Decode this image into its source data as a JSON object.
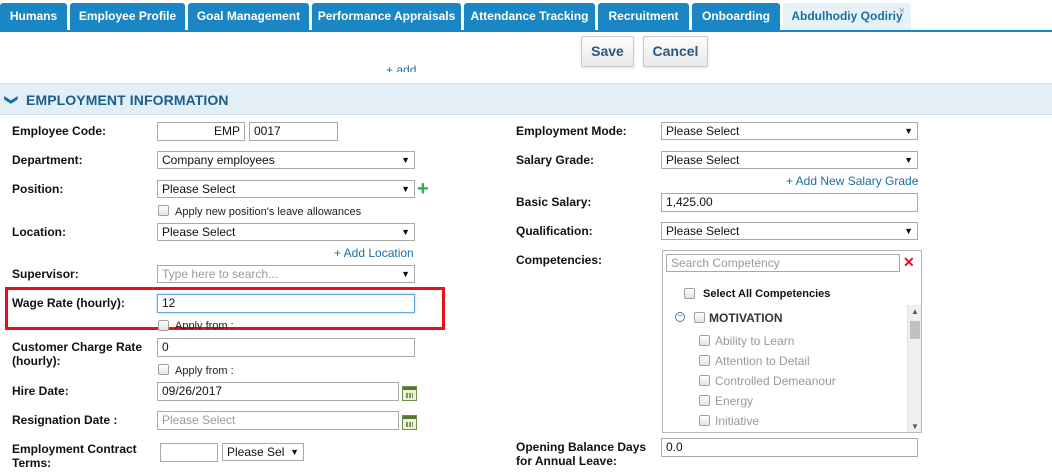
{
  "tabs": [
    {
      "label": "Humans"
    },
    {
      "label": "Employee Profile"
    },
    {
      "label": "Goal Management"
    },
    {
      "label": "Performance Appraisals"
    },
    {
      "label": "Attendance Tracking"
    },
    {
      "label": "Recruitment"
    },
    {
      "label": "Onboarding"
    },
    {
      "label": "Abdulhodiy Qodiriy",
      "close": "×"
    }
  ],
  "toolbar": {
    "save_label": "Save",
    "cancel_label": "Cancel",
    "add_link": "+ add"
  },
  "section": {
    "chevron": "❯",
    "title": "EMPLOYMENT INFORMATION"
  },
  "left": {
    "employee_code": {
      "label": "Employee Code:",
      "prefix": "EMP",
      "number": "0017"
    },
    "department": {
      "label": "Department:",
      "value": "Company employees"
    },
    "position": {
      "label": "Position:",
      "value": "Please Select",
      "add_icon": "+",
      "apply_leave": "Apply new position's leave allowances"
    },
    "location": {
      "label": "Location:",
      "value": "Please Select",
      "add_link": "+ Add Location"
    },
    "supervisor": {
      "label": "Supervisor:",
      "placeholder": "Type here to search..."
    },
    "wage_rate": {
      "label": "Wage Rate (hourly):",
      "value": "12",
      "apply_from": "Apply from :"
    },
    "customer_charge": {
      "label_line1": "Customer Charge Rate",
      "label_line2": "(hourly):",
      "value": "0",
      "apply_from": "Apply from :"
    },
    "hire_date": {
      "label": "Hire Date:",
      "value": "09/26/2017"
    },
    "resignation_date": {
      "label": "Resignation Date :",
      "placeholder": "Please Select"
    },
    "contract_terms": {
      "label_line1": "Employment Contract",
      "label_line2": "Terms:",
      "value": "",
      "unit": "Please Sel"
    }
  },
  "right": {
    "employment_mode": {
      "label": "Employment Mode:",
      "value": "Please Select"
    },
    "salary_grade": {
      "label": "Salary Grade:",
      "value": "Please Select",
      "add_link": "+ Add New Salary Grade"
    },
    "basic_salary": {
      "label": "Basic Salary:",
      "value": "1,425.00"
    },
    "qualification": {
      "label": "Qualification:",
      "value": "Please Select"
    },
    "competencies": {
      "label": "Competencies:",
      "search_placeholder": "Search Competency",
      "clear_icon": "✕",
      "select_all": "Select All Competencies",
      "group": "MOTIVATION",
      "items": [
        "Ability to Learn",
        "Attention to Detail",
        "Controlled Demeanour",
        "Energy",
        "Initiative"
      ]
    },
    "opening_balance": {
      "label_line1": "Opening Balance Days",
      "label_line2": "for Annual Leave:",
      "value": "0.0"
    }
  },
  "colors": {
    "tab_bg": "#1a87c4",
    "section_bg": "#e3eef6",
    "highlight_border": "#e4121d",
    "link": "#1a6fa0",
    "add_green": "#21b24a"
  }
}
